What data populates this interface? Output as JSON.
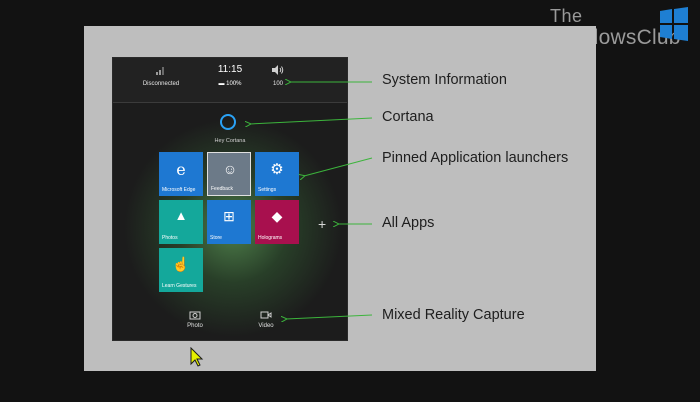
{
  "watermark": {
    "line1": "The",
    "line2": "WindowsClub",
    "logo_color": "#1e7fd3"
  },
  "system_bar": {
    "wifi": {
      "icon": "wifi-icon",
      "label": "Disconnected"
    },
    "clock": {
      "time": "11:15",
      "battery": "▬ 100%"
    },
    "volume": {
      "icon": "speaker-icon",
      "label": "100"
    }
  },
  "cortana": {
    "label": "Hey Cortana",
    "color": "#2aa2f6"
  },
  "tiles": [
    {
      "label": "Microsoft Edge",
      "icon": "edge-icon",
      "glyph": "e",
      "color": "#1e78d2"
    },
    {
      "label": "Feedback",
      "icon": "feedback-icon",
      "glyph": "☺",
      "color": "#6c7a88"
    },
    {
      "label": "Settings",
      "icon": "gear-icon",
      "glyph": "⚙",
      "color": "#1e78d2"
    },
    {
      "label": "Photos",
      "icon": "photos-icon",
      "glyph": "▲",
      "color": "#14a89b"
    },
    {
      "label": "Store",
      "icon": "store-icon",
      "glyph": "⊞",
      "color": "#1e78d2"
    },
    {
      "label": "Holograms",
      "icon": "holograms-icon",
      "glyph": "◆",
      "color": "#a8104e"
    },
    {
      "label": "Learn Gestures",
      "icon": "gesture-icon",
      "glyph": "☝",
      "color": "#14a89b"
    }
  ],
  "all_apps": {
    "glyph": "+"
  },
  "bottom_bar": {
    "photo": {
      "label": "Photo",
      "icon": "camera-icon"
    },
    "video": {
      "label": "Video",
      "icon": "video-camera-icon"
    }
  },
  "annotations": {
    "system_information": "System Information",
    "cortana": "Cortana",
    "pinned": "Pinned Application launchers",
    "all_apps": "All Apps",
    "mixed_reality": "Mixed Reality Capture"
  },
  "colors": {
    "arrow": "#3cb43c",
    "slide_bg": "#bebebe",
    "panel_bg": "#1c1c1c",
    "page_bg": "#121212"
  }
}
